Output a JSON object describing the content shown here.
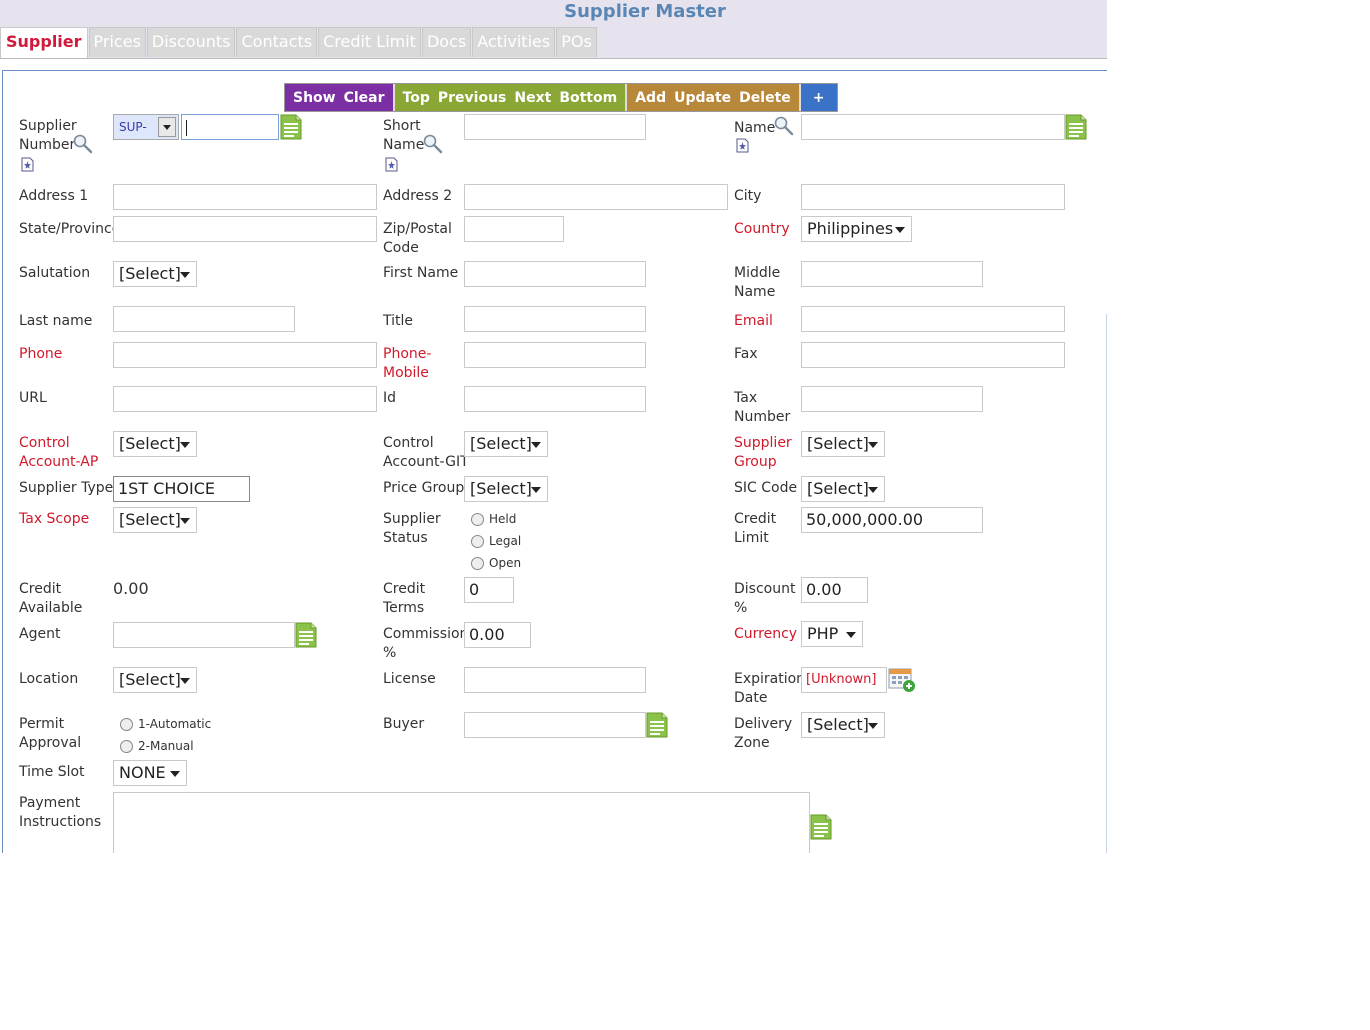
{
  "window": {
    "title": "Supplier Master"
  },
  "tabs": [
    "Supplier",
    "Prices",
    "Discounts",
    "Contacts",
    "Credit Limit",
    "Docs",
    "Activities",
    "POs"
  ],
  "toolbar": {
    "show": "Show",
    "clear": "Clear",
    "top": "Top",
    "previous": "Previous",
    "next": "Next",
    "bottom": "Bottom",
    "add": "Add",
    "update": "Update",
    "delete": "Delete",
    "plus": "+"
  },
  "labels": {
    "supplier_number_1": "Supplier",
    "supplier_number_2": "Number",
    "short_name_1": "Short",
    "short_name_2": "Name",
    "name": "Name",
    "address1": "Address 1",
    "address2": "Address 2",
    "city": "City",
    "state": "State/Province",
    "zip_1": "Zip/Postal",
    "zip_2": "Code",
    "country": "Country",
    "salutation": "Salutation",
    "first_name": "First Name",
    "middle_1": "Middle",
    "middle_2": "Name",
    "last_name": "Last name",
    "title": "Title",
    "email": "Email",
    "phone": "Phone",
    "phone_mobile_1": "Phone-",
    "phone_mobile_2": "Mobile",
    "fax": "Fax",
    "url": "URL",
    "id": "Id",
    "tax_1": "Tax",
    "tax_2": "Number",
    "control_ap_1": "Control",
    "control_ap_2": "Account-AP",
    "control_git_1": "Control",
    "control_git_2": "Account-GIT",
    "supplier_group_1": "Supplier",
    "supplier_group_2": "Group",
    "supplier_type": "Supplier Type",
    "price_group": "Price Group",
    "sic_code": "SIC Code",
    "tax_scope": "Tax Scope",
    "supplier_status_1": "Supplier",
    "supplier_status_2": "Status",
    "credit_limit_1": "Credit",
    "credit_limit_2": "Limit",
    "credit_available_1": "Credit",
    "credit_available_2": "Available",
    "credit_terms_1": "Credit",
    "credit_terms_2": "Terms",
    "discount_1": "Discount",
    "discount_2": "%",
    "agent": "Agent",
    "commission_1": "Commission",
    "commission_2": "%",
    "currency": "Currency",
    "location": "Location",
    "license": "License",
    "expiration_1": "Expiration",
    "expiration_2": "Date",
    "permit_1": "Permit",
    "permit_2": "Approval",
    "buyer": "Buyer",
    "delivery_1": "Delivery",
    "delivery_2": "Zone",
    "time_slot": "Time Slot",
    "payment_1": "Payment",
    "payment_2": "Instructions"
  },
  "values": {
    "supplier_prefix": "SUP-",
    "country": "Philippines",
    "select": "[Select]",
    "supplier_type": "1ST CHOICE",
    "credit_limit": "50,000,000.00",
    "credit_available": "0.00",
    "credit_terms": "0",
    "discount": "0.00",
    "commission": "0.00",
    "currency": "PHP",
    "expiration_date": "[Unknown]",
    "time_slot": "NONE"
  },
  "supplier_status_options": [
    "Held",
    "Legal",
    "Open"
  ],
  "permit_options": [
    "1-Automatic",
    "2-Manual"
  ],
  "colors": {
    "accent_required": "#d0192b",
    "title": "#5a86b4",
    "purple": "#7b2fa2",
    "green": "#8aa634",
    "brown": "#b8883a",
    "blue": "#3a72c8"
  }
}
